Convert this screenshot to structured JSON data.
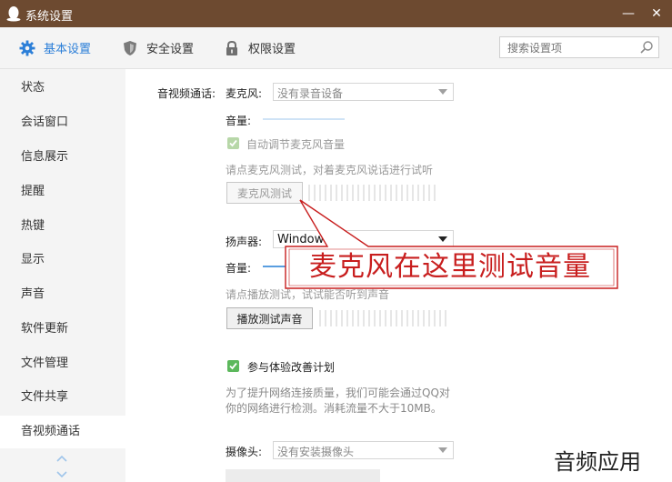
{
  "window": {
    "title": "系统设置",
    "minimize_symbol": "—",
    "close_symbol": "✕",
    "colors": {
      "titlebar": "#6d4a30",
      "accent": "#2c7fd8",
      "annotation_red": "#c81e1e"
    }
  },
  "tabs": [
    {
      "label": "基本设置",
      "icon": "gear-icon",
      "active": true
    },
    {
      "label": "安全设置",
      "icon": "shield-icon",
      "active": false
    },
    {
      "label": "权限设置",
      "icon": "lock-icon",
      "active": false
    }
  ],
  "search": {
    "placeholder": "搜索设置项",
    "icon": "search-icon"
  },
  "sidebar": {
    "items": [
      {
        "label": "状态"
      },
      {
        "label": "会话窗口"
      },
      {
        "label": "信息展示"
      },
      {
        "label": "提醒"
      },
      {
        "label": "热键"
      },
      {
        "label": "显示"
      },
      {
        "label": "声音"
      },
      {
        "label": "软件更新"
      },
      {
        "label": "文件管理"
      },
      {
        "label": "文件共享"
      },
      {
        "label": "音视频通话",
        "active": true
      }
    ]
  },
  "av": {
    "section_label": "音视频通话:",
    "mic": {
      "label": "麦克风:",
      "selected": "没有录音设备",
      "volume_label": "音量:",
      "auto_adjust_label": "自动调节麦克风音量",
      "auto_adjust_checked": true,
      "hint": "请点麦克风测试，对着麦克风说话进行试听",
      "test_button": "麦克风测试"
    },
    "speaker": {
      "label": "扬声器:",
      "selected": "Windows",
      "volume_label": "音量:",
      "hint": "请点播放测试，试试能否听到声音",
      "test_button": "播放测试声音"
    },
    "experience": {
      "label": "参与体验改善计划",
      "checked": true,
      "desc_line1": "为了提升网络连接质量，我们可能会通过QQ对",
      "desc_line2": "你的网络进行检测。消耗流量不大于10MB。"
    },
    "camera": {
      "label": "摄像头:",
      "selected": "没有安装摄像头"
    }
  },
  "annotation": {
    "text": "麦克风在这里测试音量"
  },
  "watermark": {
    "text": "音频应用"
  }
}
